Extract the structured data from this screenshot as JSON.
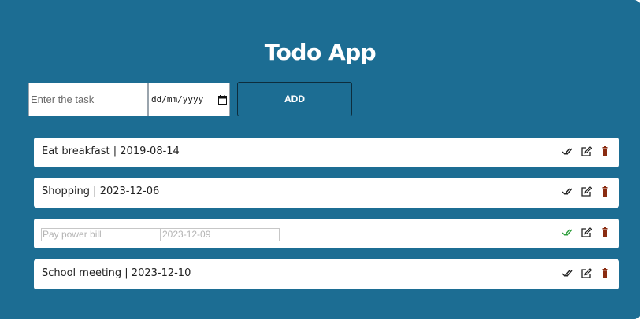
{
  "header": {
    "title": "Todo App"
  },
  "form": {
    "task_placeholder": "Enter the task",
    "date_placeholder": "dd/mm/yyyy",
    "add_label": "ADD"
  },
  "todos": [
    {
      "text": "Eat breakfast | 2019-08-14",
      "state": "normal"
    },
    {
      "text": "Shopping | 2023-12-06",
      "state": "normal"
    },
    {
      "state": "editing",
      "task_value": "Pay power bill",
      "date_value": "2023-12-09",
      "complete_icon_color": "#2e9e3c"
    },
    {
      "text": "School meeting | 2023-12-10",
      "state": "normal"
    }
  ],
  "colors": {
    "background": "#1c6d93",
    "delete_icon": "#8a2b10",
    "check_icon": "#222222"
  },
  "icons": {
    "complete": "double-check-icon",
    "edit": "edit-icon",
    "delete": "trash-icon"
  }
}
